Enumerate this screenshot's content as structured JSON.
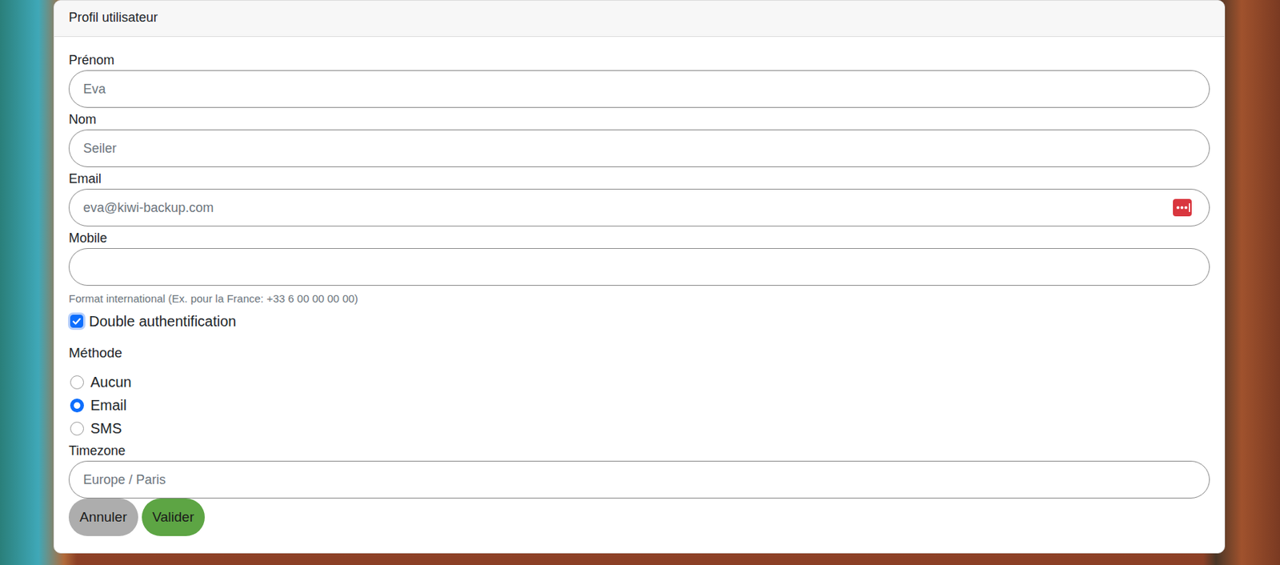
{
  "card": {
    "title": "Profil utilisateur"
  },
  "fields": [
    {
      "label": "Prénom",
      "value": "Eva",
      "kind": "text",
      "help": ""
    },
    {
      "label": "Nom",
      "value": "Seiler",
      "kind": "text",
      "help": ""
    },
    {
      "label": "Email",
      "value": "eva@kiwi-backup.com",
      "kind": "email",
      "help": ""
    },
    {
      "label": "Mobile",
      "value": "",
      "kind": "tel",
      "help": "Format international (Ex. pour la France: +33 6 00 00 00 00)"
    }
  ],
  "two_factor": {
    "label": "Double authentification",
    "checked": true
  },
  "method": {
    "label": "Méthode",
    "options": [
      {
        "label": "Aucun",
        "selected": false
      },
      {
        "label": "Email",
        "selected": true
      },
      {
        "label": "SMS",
        "selected": false
      }
    ]
  },
  "timezone": {
    "label": "Timezone",
    "value": "Europe / Paris"
  },
  "buttons": [
    {
      "label": "Annuler",
      "kind": "cancel"
    },
    {
      "label": "Valider",
      "kind": "submit"
    }
  ]
}
